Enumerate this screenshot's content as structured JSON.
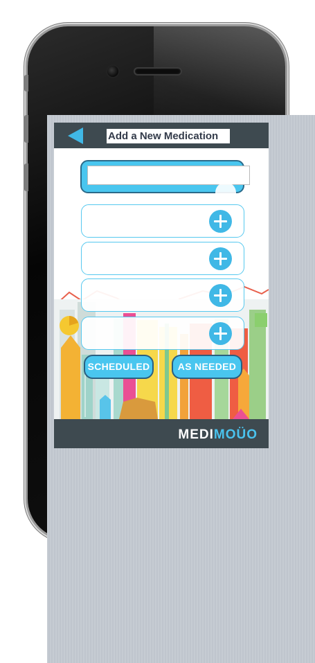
{
  "header": {
    "back_icon": "left-triangle-icon",
    "title": "Add a New Medication"
  },
  "form": {
    "name_field": {
      "value": "",
      "placeholder": ""
    },
    "fields": [
      {
        "value": "",
        "icon": "plus-circle-icon"
      },
      {
        "value": "",
        "icon": "plus-circle-icon"
      },
      {
        "value": "",
        "icon": "plus-circle-icon"
      },
      {
        "value": "",
        "icon": "plus-circle-icon"
      }
    ],
    "scheduled_label": "SCHEDULED",
    "as_needed_label": "AS NEEDED"
  },
  "footer": {
    "brand_part1": "MEDI",
    "brand_part2": "MOÜO"
  },
  "colors": {
    "bar": "#3e4a50",
    "accent": "#40b8e6",
    "panel": "#c6ccd3"
  }
}
